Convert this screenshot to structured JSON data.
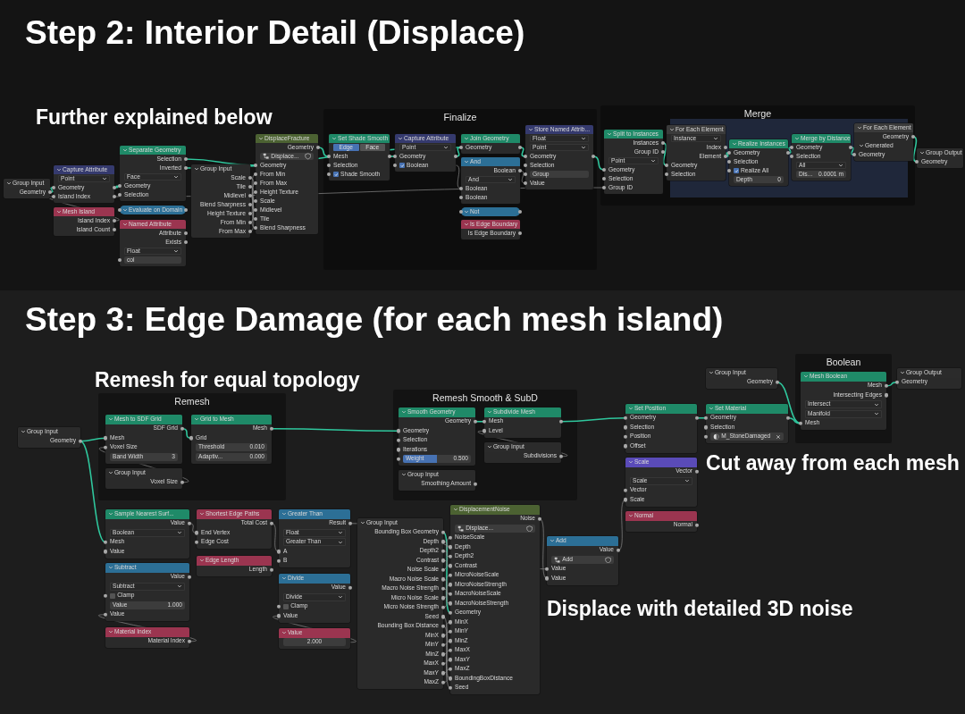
{
  "panels": [
    {
      "heading": "Step 2: Interior Detail (Displace)",
      "notes": [
        "Further explained below"
      ],
      "frames": [
        {
          "label": "Finalize"
        },
        {
          "label": "Merge"
        }
      ],
      "nodes": [
        {
          "title": "Group Input",
          "kind": "interface",
          "collapsed": false,
          "rows": [
            {
              "kind": "out",
              "label": "Geometry"
            }
          ]
        },
        {
          "title": "Capture Attribute",
          "kind": "attribute",
          "collapsed": false,
          "rows": [
            {
              "kind": "dropdown",
              "value": "Point"
            },
            {
              "kind": "io",
              "label": "Geometry"
            },
            {
              "kind": "io",
              "label": "Island Index"
            }
          ]
        },
        {
          "title": "Mesh Island",
          "kind": "input",
          "collapsed": false,
          "rows": [
            {
              "kind": "out",
              "label": "Island Index"
            },
            {
              "kind": "out",
              "label": "Island Count"
            }
          ]
        },
        {
          "title": "Separate Geometry",
          "kind": "geometry",
          "collapsed": false,
          "rows": [
            {
              "kind": "out",
              "label": "Selection"
            },
            {
              "kind": "out",
              "label": "Inverted"
            },
            {
              "kind": "dropdown",
              "value": "Face"
            },
            {
              "kind": "in",
              "label": "Geometry"
            },
            {
              "kind": "in",
              "label": "Selection"
            }
          ]
        },
        {
          "title": "Evaluate on Domain",
          "kind": "math",
          "collapsed": true
        },
        {
          "title": "Named Attribute",
          "kind": "input",
          "collapsed": false,
          "rows": [
            {
              "kind": "out",
              "label": "Attribute"
            },
            {
              "kind": "out",
              "label": "Exists"
            },
            {
              "kind": "dropdown",
              "value": "Float"
            },
            {
              "kind": "text",
              "value": "col"
            }
          ]
        },
        {
          "title": "Group Input",
          "kind": "interface",
          "collapsed": false,
          "rows": [
            {
              "kind": "out",
              "label": "Scale"
            },
            {
              "kind": "out",
              "label": "Tile"
            },
            {
              "kind": "out",
              "label": "Midlevel"
            },
            {
              "kind": "out",
              "label": "Blend Sharpness"
            },
            {
              "kind": "out",
              "label": "Height Texture"
            },
            {
              "kind": "out",
              "label": "From Min"
            },
            {
              "kind": "out",
              "label": "From Max"
            }
          ]
        },
        {
          "title": "DisplaceFracture",
          "kind": "group",
          "collapsed": false,
          "rows": [
            {
              "kind": "out",
              "label": "Geometry"
            },
            {
              "kind": "group",
              "value": "Displace..."
            },
            {
              "kind": "in",
              "label": "Geometry"
            },
            {
              "kind": "in",
              "label": "From Min"
            },
            {
              "kind": "in",
              "label": "From Max"
            },
            {
              "kind": "in",
              "label": "Height Texture"
            },
            {
              "kind": "in",
              "label": "Scale"
            },
            {
              "kind": "in",
              "label": "Midlevel"
            },
            {
              "kind": "in",
              "label": "Tile"
            },
            {
              "kind": "in",
              "label": "Blend Sharpness"
            }
          ]
        },
        {
          "title": "Set Shade Smooth",
          "kind": "geometry",
          "collapsed": false,
          "rows": [
            {
              "kind": "toggle",
              "options": [
                {
                  "label": "Edge",
                  "selected": true
                },
                {
                  "label": "Face",
                  "selected": false
                }
              ]
            },
            {
              "kind": "io",
              "label": "Mesh"
            },
            {
              "kind": "in",
              "label": "Selection"
            },
            {
              "kind": "check",
              "label": "Shade Smooth",
              "checked": true
            }
          ]
        },
        {
          "title": "Capture Attribute",
          "kind": "attribute",
          "collapsed": false,
          "rows": [
            {
              "kind": "dropdown",
              "value": "Point"
            },
            {
              "kind": "io",
              "label": "Geometry"
            },
            {
              "kind": "check",
              "label": "Boolean",
              "checked": true
            }
          ]
        },
        {
          "title": "Join Geometry",
          "kind": "geometry",
          "collapsed": false,
          "rows": [
            {
              "kind": "io",
              "label": "Geometry"
            }
          ]
        },
        {
          "title": "And",
          "kind": "math",
          "collapsed": false,
          "rows": [
            {
              "kind": "out",
              "label": "Boolean"
            },
            {
              "kind": "dropdown",
              "value": "And"
            },
            {
              "kind": "in",
              "label": "Boolean"
            },
            {
              "kind": "in",
              "label": "Boolean"
            }
          ]
        },
        {
          "title": "Not",
          "kind": "math",
          "collapsed": true
        },
        {
          "title": "Is Edge Boundary",
          "kind": "input",
          "collapsed": false,
          "rows": [
            {
              "kind": "out",
              "label": "Is Edge Boundary"
            }
          ]
        },
        {
          "title": "Store Named Attrib...",
          "kind": "attribute",
          "collapsed": false,
          "rows": [
            {
              "kind": "dropdown",
              "value": "Float"
            },
            {
              "kind": "dropdown",
              "value": "Point"
            },
            {
              "kind": "io",
              "label": "Geometry"
            },
            {
              "kind": "in",
              "label": "Selection"
            },
            {
              "kind": "text",
              "value": "Group"
            },
            {
              "kind": "in",
              "label": "Value"
            }
          ]
        },
        {
          "title": "Split to Instances",
          "kind": "geometry",
          "collapsed": false,
          "rows": [
            {
              "kind": "out",
              "label": "Instances"
            },
            {
              "kind": "out",
              "label": "Group ID"
            },
            {
              "kind": "dropdown",
              "value": "Point"
            },
            {
              "kind": "in",
              "label": "Geometry"
            },
            {
              "kind": "in",
              "label": "Selection"
            },
            {
              "kind": "in",
              "label": "Group ID"
            }
          ]
        },
        {
          "title": "For Each Element",
          "kind": "zone",
          "collapsed": false,
          "rows": [
            {
              "kind": "dropdown",
              "value": "Instance"
            },
            {
              "kind": "out",
              "label": "Index"
            },
            {
              "kind": "out",
              "label": "Element"
            },
            {
              "kind": "in",
              "label": "Geometry"
            },
            {
              "kind": "in",
              "label": "Selection"
            }
          ]
        },
        {
          "title": "Realize Instances",
          "kind": "geometry",
          "collapsed": false,
          "rows": [
            {
              "kind": "io",
              "label": "Geometry"
            },
            {
              "kind": "in",
              "label": "Selection"
            },
            {
              "kind": "check",
              "label": "Realize All",
              "checked": true
            },
            {
              "kind": "field",
              "label": "Depth",
              "value": "0"
            }
          ]
        },
        {
          "title": "Merge by Distance",
          "kind": "geometry",
          "collapsed": false,
          "rows": [
            {
              "kind": "io",
              "label": "Geometry"
            },
            {
              "kind": "in",
              "label": "Selection"
            },
            {
              "kind": "dropdown",
              "value": "All"
            },
            {
              "kind": "field",
              "label": "Dis...",
              "value": "0.0001 m"
            }
          ]
        },
        {
          "title": "For Each Element",
          "kind": "zone",
          "collapsed": false,
          "rows": [
            {
              "kind": "out",
              "label": "Geometry"
            },
            {
              "kind": "sub",
              "label": "Generated"
            },
            {
              "kind": "in",
              "label": "Geometry"
            }
          ]
        },
        {
          "title": "Group Output",
          "kind": "interface",
          "collapsed": false,
          "rows": [
            {
              "kind": "in",
              "label": "Geometry"
            }
          ]
        }
      ]
    },
    {
      "heading": "Step 3: Edge Damage (for each mesh island)",
      "notes": [
        "Remesh for equal topology",
        "Cut away from each mesh",
        "Displace with detailed 3D noise"
      ],
      "frames": [
        {
          "label": "Remesh"
        },
        {
          "label": "Remesh Smooth & SubD"
        },
        {
          "label": "Boolean"
        }
      ],
      "nodes": [
        {
          "title": "Group Input",
          "kind": "interface",
          "collapsed": false,
          "rows": [
            {
              "kind": "out",
              "label": "Geometry"
            }
          ]
        },
        {
          "title": "Mesh to SDF Grid",
          "kind": "geometry",
          "collapsed": false,
          "rows": [
            {
              "kind": "out",
              "label": "SDF Grid"
            },
            {
              "kind": "in",
              "label": "Mesh"
            },
            {
              "kind": "in",
              "label": "Voxel Size"
            },
            {
              "kind": "field",
              "label": "Band Width",
              "value": "3"
            }
          ]
        },
        {
          "title": "Group Input",
          "kind": "interface",
          "collapsed": false,
          "rows": [
            {
              "kind": "out",
              "label": "Voxel Size"
            }
          ]
        },
        {
          "title": "Grid to Mesh",
          "kind": "geometry",
          "collapsed": false,
          "rows": [
            {
              "kind": "out",
              "label": "Mesh"
            },
            {
              "kind": "in",
              "label": "Grid"
            },
            {
              "kind": "field",
              "label": "Threshold",
              "value": "0.010"
            },
            {
              "kind": "field",
              "label": "Adaptiv...",
              "value": "0.000"
            }
          ]
        },
        {
          "title": "Sample Nearest Surf...",
          "kind": "geometry",
          "collapsed": false,
          "rows": [
            {
              "kind": "out",
              "label": "Value"
            },
            {
              "kind": "dropdown",
              "value": "Boolean"
            },
            {
              "kind": "in",
              "label": "Mesh"
            },
            {
              "kind": "in",
              "label": "Value"
            }
          ]
        },
        {
          "title": "Subtract",
          "kind": "math",
          "collapsed": false,
          "rows": [
            {
              "kind": "out",
              "label": "Value"
            },
            {
              "kind": "dropdown",
              "value": "Subtract"
            },
            {
              "kind": "check",
              "label": "Clamp",
              "checked": false
            },
            {
              "kind": "field",
              "label": "Value",
              "value": "1.000"
            },
            {
              "kind": "in",
              "label": "Value"
            }
          ]
        },
        {
          "title": "Material Index",
          "kind": "input",
          "collapsed": false,
          "rows": [
            {
              "kind": "out",
              "label": "Material Index"
            }
          ]
        },
        {
          "title": "Shortest Edge Paths",
          "kind": "input",
          "collapsed": false,
          "rows": [
            {
              "kind": "out",
              "label": "Total Cost"
            },
            {
              "kind": "in",
              "label": "End Vertex"
            },
            {
              "kind": "in",
              "label": "Edge Cost"
            }
          ]
        },
        {
          "title": "Edge Length",
          "kind": "input",
          "collapsed": false,
          "rows": [
            {
              "kind": "out",
              "label": "Length"
            }
          ]
        },
        {
          "title": "Greater Than",
          "kind": "math",
          "collapsed": false,
          "rows": [
            {
              "kind": "out",
              "label": "Result"
            },
            {
              "kind": "dropdown",
              "value": "Float"
            },
            {
              "kind": "dropdown",
              "value": "Greater Than"
            },
            {
              "kind": "in",
              "label": "A"
            },
            {
              "kind": "in",
              "label": "B"
            }
          ]
        },
        {
          "title": "Divide",
          "kind": "math",
          "collapsed": false,
          "rows": [
            {
              "kind": "out",
              "label": "Value"
            },
            {
              "kind": "dropdown",
              "value": "Divide"
            },
            {
              "kind": "check",
              "label": "Clamp",
              "checked": false
            },
            {
              "kind": "in",
              "label": "Value"
            }
          ]
        },
        {
          "title": "Value",
          "kind": "input",
          "collapsed": false,
          "rows": [
            {
              "kind": "field",
              "value": "2.000"
            }
          ]
        },
        {
          "title": "Group Input",
          "kind": "interface",
          "collapsed": false,
          "rows": [
            {
              "kind": "out",
              "label": "Bounding Box Geometry"
            },
            {
              "kind": "out",
              "label": "Depth"
            },
            {
              "kind": "out",
              "label": "Depth2"
            },
            {
              "kind": "out",
              "label": "Contrast"
            },
            {
              "kind": "out",
              "label": "Noise Scale"
            },
            {
              "kind": "out",
              "label": "Macro Noise Scale"
            },
            {
              "kind": "out",
              "label": "Macro Noise Strength"
            },
            {
              "kind": "out",
              "label": "Micro Noise Scale"
            },
            {
              "kind": "out",
              "label": "Micro Noise Strength"
            },
            {
              "kind": "out",
              "label": "Seed"
            },
            {
              "kind": "out",
              "label": "Bounding Box Distance"
            },
            {
              "kind": "out",
              "label": "MinX"
            },
            {
              "kind": "out",
              "label": "MinY"
            },
            {
              "kind": "out",
              "label": "MinZ"
            },
            {
              "kind": "out",
              "label": "MaxX"
            },
            {
              "kind": "out",
              "label": "MaxY"
            },
            {
              "kind": "out",
              "label": "MaxZ"
            }
          ]
        },
        {
          "title": "DisplacementNoise",
          "kind": "group",
          "collapsed": false,
          "rows": [
            {
              "kind": "out",
              "label": "Noise"
            },
            {
              "kind": "group",
              "value": "Displace..."
            },
            {
              "kind": "in",
              "label": "NoiseScale"
            },
            {
              "kind": "in",
              "label": "Depth"
            },
            {
              "kind": "in",
              "label": "Depth2"
            },
            {
              "kind": "in",
              "label": "Contrast"
            },
            {
              "kind": "in",
              "label": "MicroNoiseScale"
            },
            {
              "kind": "in",
              "label": "MicroNoiseStrength"
            },
            {
              "kind": "in",
              "label": "MacroNoiseScale"
            },
            {
              "kind": "in",
              "label": "MacroNoiseStrength"
            },
            {
              "kind": "in",
              "label": "Geometry"
            },
            {
              "kind": "in",
              "label": "MinX"
            },
            {
              "kind": "in",
              "label": "MinY"
            },
            {
              "kind": "in",
              "label": "MinZ"
            },
            {
              "kind": "in",
              "label": "MaxX"
            },
            {
              "kind": "in",
              "label": "MaxY"
            },
            {
              "kind": "in",
              "label": "MaxZ"
            },
            {
              "kind": "in",
              "label": "BoundingBoxDistance"
            },
            {
              "kind": "in",
              "label": "Seed"
            }
          ]
        },
        {
          "title": "Smooth Geometry",
          "kind": "geometry",
          "collapsed": false,
          "rows": [
            {
              "kind": "out",
              "label": "Geometry"
            },
            {
              "kind": "in",
              "label": "Geometry"
            },
            {
              "kind": "in",
              "label": "Selection"
            },
            {
              "kind": "in",
              "label": "Iterations"
            },
            {
              "kind": "slider",
              "label": "Weight",
              "value": "0.500",
              "level": 0.5
            }
          ]
        },
        {
          "title": "Group Input",
          "kind": "interface",
          "collapsed": false,
          "rows": [
            {
              "kind": "out",
              "label": "Smoothing Amount"
            }
          ]
        },
        {
          "title": "Subdivide Mesh",
          "kind": "geometry",
          "collapsed": false,
          "rows": [
            {
              "kind": "io",
              "label": "Mesh"
            },
            {
              "kind": "in",
              "label": "Level"
            }
          ]
        },
        {
          "title": "Group Input",
          "kind": "interface",
          "collapsed": false,
          "rows": [
            {
              "kind": "out",
              "label": "Subdivisions"
            }
          ]
        },
        {
          "title": "Add",
          "kind": "math",
          "collapsed": false,
          "rows": [
            {
              "kind": "out",
              "label": "Value"
            },
            {
              "kind": "group",
              "value": "Add"
            },
            {
              "kind": "in",
              "label": "Value"
            },
            {
              "kind": "in",
              "label": "Value"
            }
          ]
        },
        {
          "title": "Set Position",
          "kind": "geometry",
          "collapsed": false,
          "rows": [
            {
              "kind": "io",
              "label": "Geometry"
            },
            {
              "kind": "in",
              "label": "Selection"
            },
            {
              "kind": "in",
              "label": "Position"
            },
            {
              "kind": "in",
              "label": "Offset"
            }
          ]
        },
        {
          "title": "Scale",
          "kind": "vector",
          "collapsed": false,
          "rows": [
            {
              "kind": "out",
              "label": "Vector"
            },
            {
              "kind": "dropdown",
              "value": "Scale"
            },
            {
              "kind": "in",
              "label": "Vector"
            },
            {
              "kind": "in",
              "label": "Scale"
            }
          ]
        },
        {
          "title": "Normal",
          "kind": "input",
          "collapsed": false,
          "rows": [
            {
              "kind": "out",
              "label": "Normal"
            }
          ]
        },
        {
          "title": "Group Input",
          "kind": "interface",
          "collapsed": false,
          "rows": [
            {
              "kind": "out",
              "label": "Geometry"
            }
          ]
        },
        {
          "title": "Set Material",
          "kind": "geometry",
          "collapsed": false,
          "rows": [
            {
              "kind": "io",
              "label": "Geometry"
            },
            {
              "kind": "in",
              "label": "Selection"
            },
            {
              "kind": "material",
              "value": "M_StoneDamaged"
            }
          ]
        },
        {
          "title": "Mesh Boolean",
          "kind": "geometry",
          "collapsed": false,
          "rows": [
            {
              "kind": "out",
              "label": "Mesh"
            },
            {
              "kind": "out",
              "label": "Intersecting Edges"
            },
            {
              "kind": "dropdown",
              "value": "Intersect"
            },
            {
              "kind": "dropdown",
              "value": "Manifold"
            },
            {
              "kind": "in",
              "label": "Mesh"
            }
          ]
        },
        {
          "title": "Group Output",
          "kind": "interface",
          "collapsed": false,
          "rows": [
            {
              "kind": "in",
              "label": "Geometry"
            }
          ]
        }
      ]
    }
  ]
}
